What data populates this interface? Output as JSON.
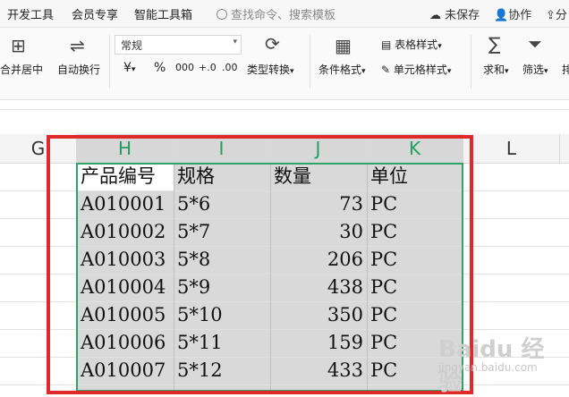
{
  "menubar": {
    "tabs": [
      "开发工具",
      "会员专享",
      "智能工具箱"
    ],
    "search_placeholder": "查找命令、搜索模板",
    "unsaved_label": "未保存",
    "collab_label": "协作",
    "share_label": "分"
  },
  "ribbon": {
    "merge_center": "合并居中",
    "auto_wrap": "自动换行",
    "number_format": "常规",
    "currency": "¥",
    "percent": "%",
    "thousands": "000",
    "inc_decimal": "+.0",
    "dec_decimal": ".00",
    "type_convert": "类型转换",
    "conditional_format": "条件格式",
    "table_style": "表格样式",
    "cell_style": "单元格样式",
    "sum": "求和",
    "filter": "筛选",
    "sort": "排"
  },
  "grid": {
    "columns": [
      "G",
      "H",
      "I",
      "J",
      "K",
      "L"
    ],
    "headers": [
      "产品编号",
      "规格",
      "数量",
      "单位"
    ],
    "rows": [
      {
        "code": "A010001",
        "spec": "5*6",
        "qty": "73",
        "unit": "PC"
      },
      {
        "code": "A010002",
        "spec": "5*7",
        "qty": "30",
        "unit": "PC"
      },
      {
        "code": "A010003",
        "spec": "5*8",
        "qty": "206",
        "unit": "PC"
      },
      {
        "code": "A010004",
        "spec": "5*9",
        "qty": "438",
        "unit": "PC"
      },
      {
        "code": "A010005",
        "spec": "5*10",
        "qty": "350",
        "unit": "PC"
      },
      {
        "code": "A010006",
        "spec": "5*11",
        "qty": "159",
        "unit": "PC"
      },
      {
        "code": "A010007",
        "spec": "5*12",
        "qty": "433",
        "unit": "PC"
      }
    ]
  },
  "watermark": {
    "main": "Baidu 经验",
    "sub": "jingyan.baidu.com"
  }
}
